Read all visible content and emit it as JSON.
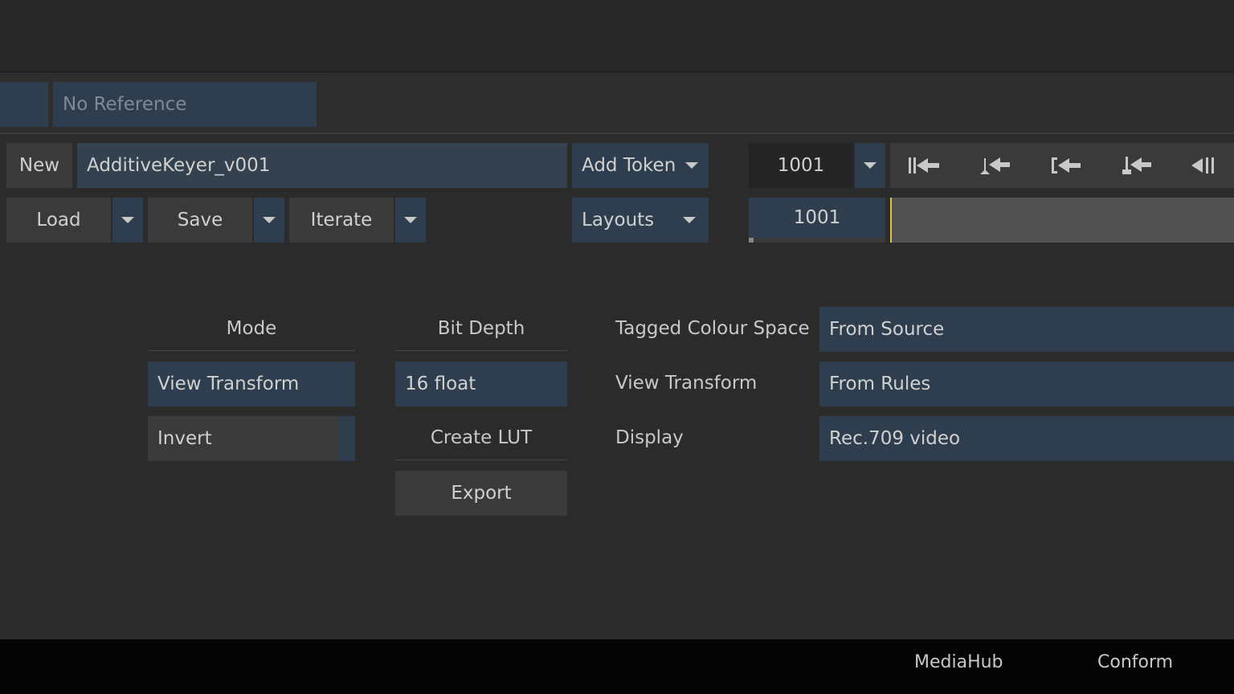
{
  "reference": {
    "placeholder": "No Reference"
  },
  "batch": {
    "new_label": "New",
    "name_value": "AdditiveKeyer_v001",
    "add_token_label": "Add Token",
    "load_label": "Load",
    "save_label": "Save",
    "iterate_label": "Iterate",
    "layouts_label": "Layouts"
  },
  "player": {
    "frame_value": "1001",
    "timeline_frame": "1001",
    "icons": [
      "goto-start-icon",
      "prev-keyframe-icon",
      "goto-in-icon",
      "prev-marker-icon",
      "play-backward-icon"
    ]
  },
  "lut": {
    "mode_heading": "Mode",
    "mode_value": "View Transform",
    "invert_label": "Invert",
    "bitdepth_heading": "Bit Depth",
    "bitdepth_value": "16 float",
    "create_lut_heading": "Create LUT",
    "export_label": "Export",
    "tagged_label": "Tagged Colour Space",
    "tagged_value": "From Source",
    "view_label": "View Transform",
    "view_value": "From Rules",
    "display_label": "Display",
    "display_value": "Rec.709 video"
  },
  "bottom_tabs": {
    "mediahub": "MediaHub",
    "conform": "Conform"
  },
  "colors": {
    "accent_blue": "#2e3e4e",
    "playhead": "#e0c040"
  }
}
